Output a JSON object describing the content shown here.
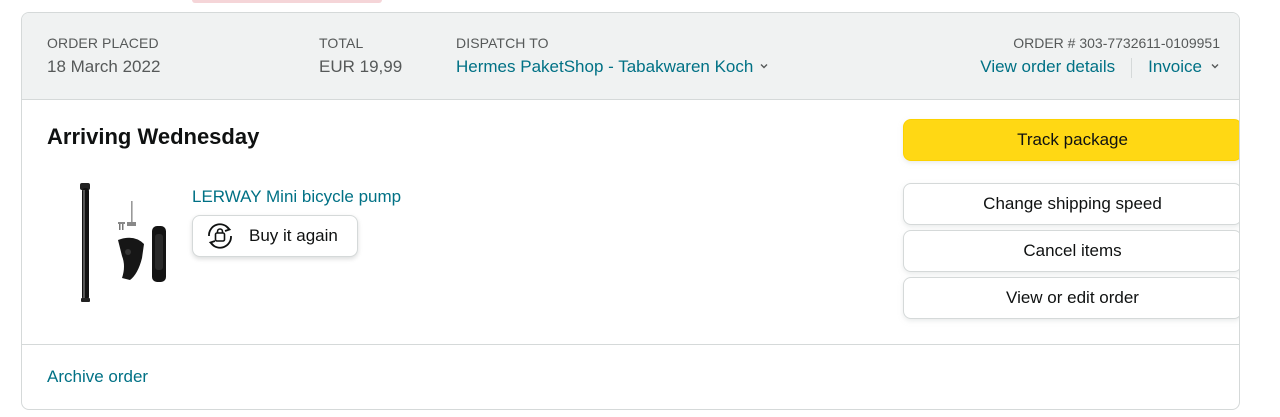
{
  "header": {
    "order_placed_label": "ORDER PLACED",
    "order_placed_value": "18 March 2022",
    "total_label": "TOTAL",
    "total_value": "EUR 19,99",
    "dispatch_label": "DISPATCH TO",
    "dispatch_value": "Hermes PaketShop - Tabakwaren Koch",
    "order_number": "ORDER # 303-7732611-0109951",
    "view_details_label": "View order details",
    "invoice_label": "Invoice"
  },
  "shipment": {
    "status": "Arriving Wednesday",
    "product_title": "LERWAY Mini bicycle pump",
    "product_image_icon": "bicycle-pump-image",
    "buy_again_label": "Buy it again",
    "buy_again_icon": "reorder-icon"
  },
  "actions": {
    "track_label": "Track package",
    "change_speed_label": "Change shipping speed",
    "cancel_label": "Cancel items",
    "edit_label": "View or edit order"
  },
  "footer": {
    "archive_label": "Archive order"
  },
  "colors": {
    "link": "#007185",
    "primary_button": "#FFD814",
    "header_bg": "#F0F2F2",
    "border": "#D5D9D9"
  }
}
